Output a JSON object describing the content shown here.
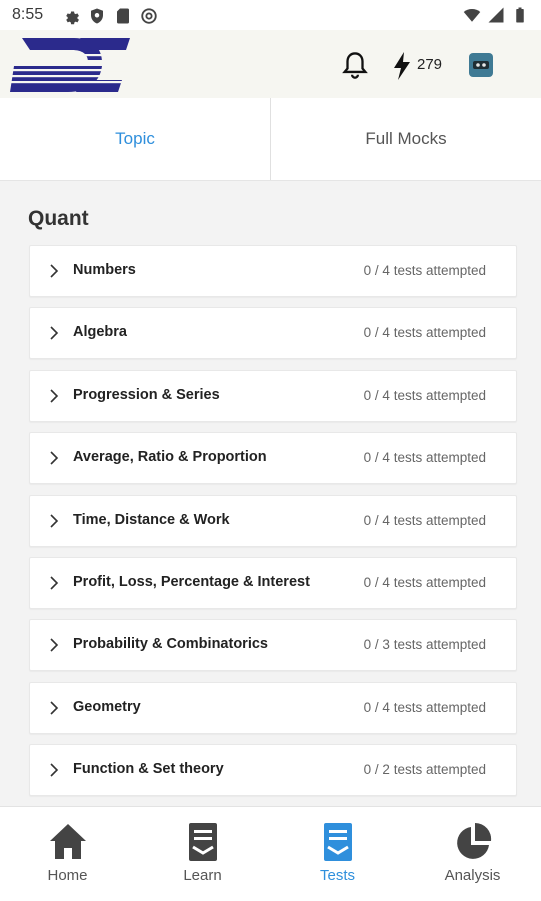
{
  "status_bar": {
    "time": "8:55",
    "left_icons": [
      "gear-icon",
      "shield-icon",
      "sd-card-icon",
      "at-sign-icon"
    ],
    "right_icons": [
      "wifi-icon",
      "signal-icon",
      "battery-icon"
    ]
  },
  "header": {
    "logo_icon": "dc-logo",
    "notification_icon": "bell-icon",
    "bolt_icon": "lightning-icon",
    "bolt_count": "279",
    "profile_icon": "profile-icon"
  },
  "tabs": [
    {
      "label": "Topic",
      "active": true
    },
    {
      "label": "Full Mocks",
      "active": false
    }
  ],
  "section": {
    "title": "Quant",
    "topics": [
      {
        "name": "Numbers",
        "status": "0 / 4 tests attempted"
      },
      {
        "name": "Algebra",
        "status": "0 / 4 tests attempted"
      },
      {
        "name": "Progression & Series",
        "status": "0 / 4 tests attempted"
      },
      {
        "name": "Average, Ratio & Proportion",
        "status": "0 / 4 tests attempted"
      },
      {
        "name": "Time, Distance & Work",
        "status": "0 / 4 tests attempted"
      },
      {
        "name": "Profit, Loss, Percentage & Interest",
        "status": "0 / 4 tests attempted"
      },
      {
        "name": "Probability & Combinatorics",
        "status": "0 / 3 tests attempted"
      },
      {
        "name": "Geometry",
        "status": "0 / 4 tests attempted"
      },
      {
        "name": "Function & Set theory",
        "status": "0 / 2 tests attempted"
      }
    ]
  },
  "bottom_nav": [
    {
      "label": "Home",
      "icon": "home-icon",
      "active": false
    },
    {
      "label": "Learn",
      "icon": "learn-icon",
      "active": false
    },
    {
      "label": "Tests",
      "icon": "tests-icon",
      "active": true
    },
    {
      "label": "Analysis",
      "icon": "pie-chart-icon",
      "active": false
    }
  ],
  "colors": {
    "accent": "#2f8fdc",
    "logo": "#2b2a8c",
    "header_bg": "#f6f6f1",
    "content_bg": "#f3f3f3",
    "icon_dark": "#444444"
  }
}
